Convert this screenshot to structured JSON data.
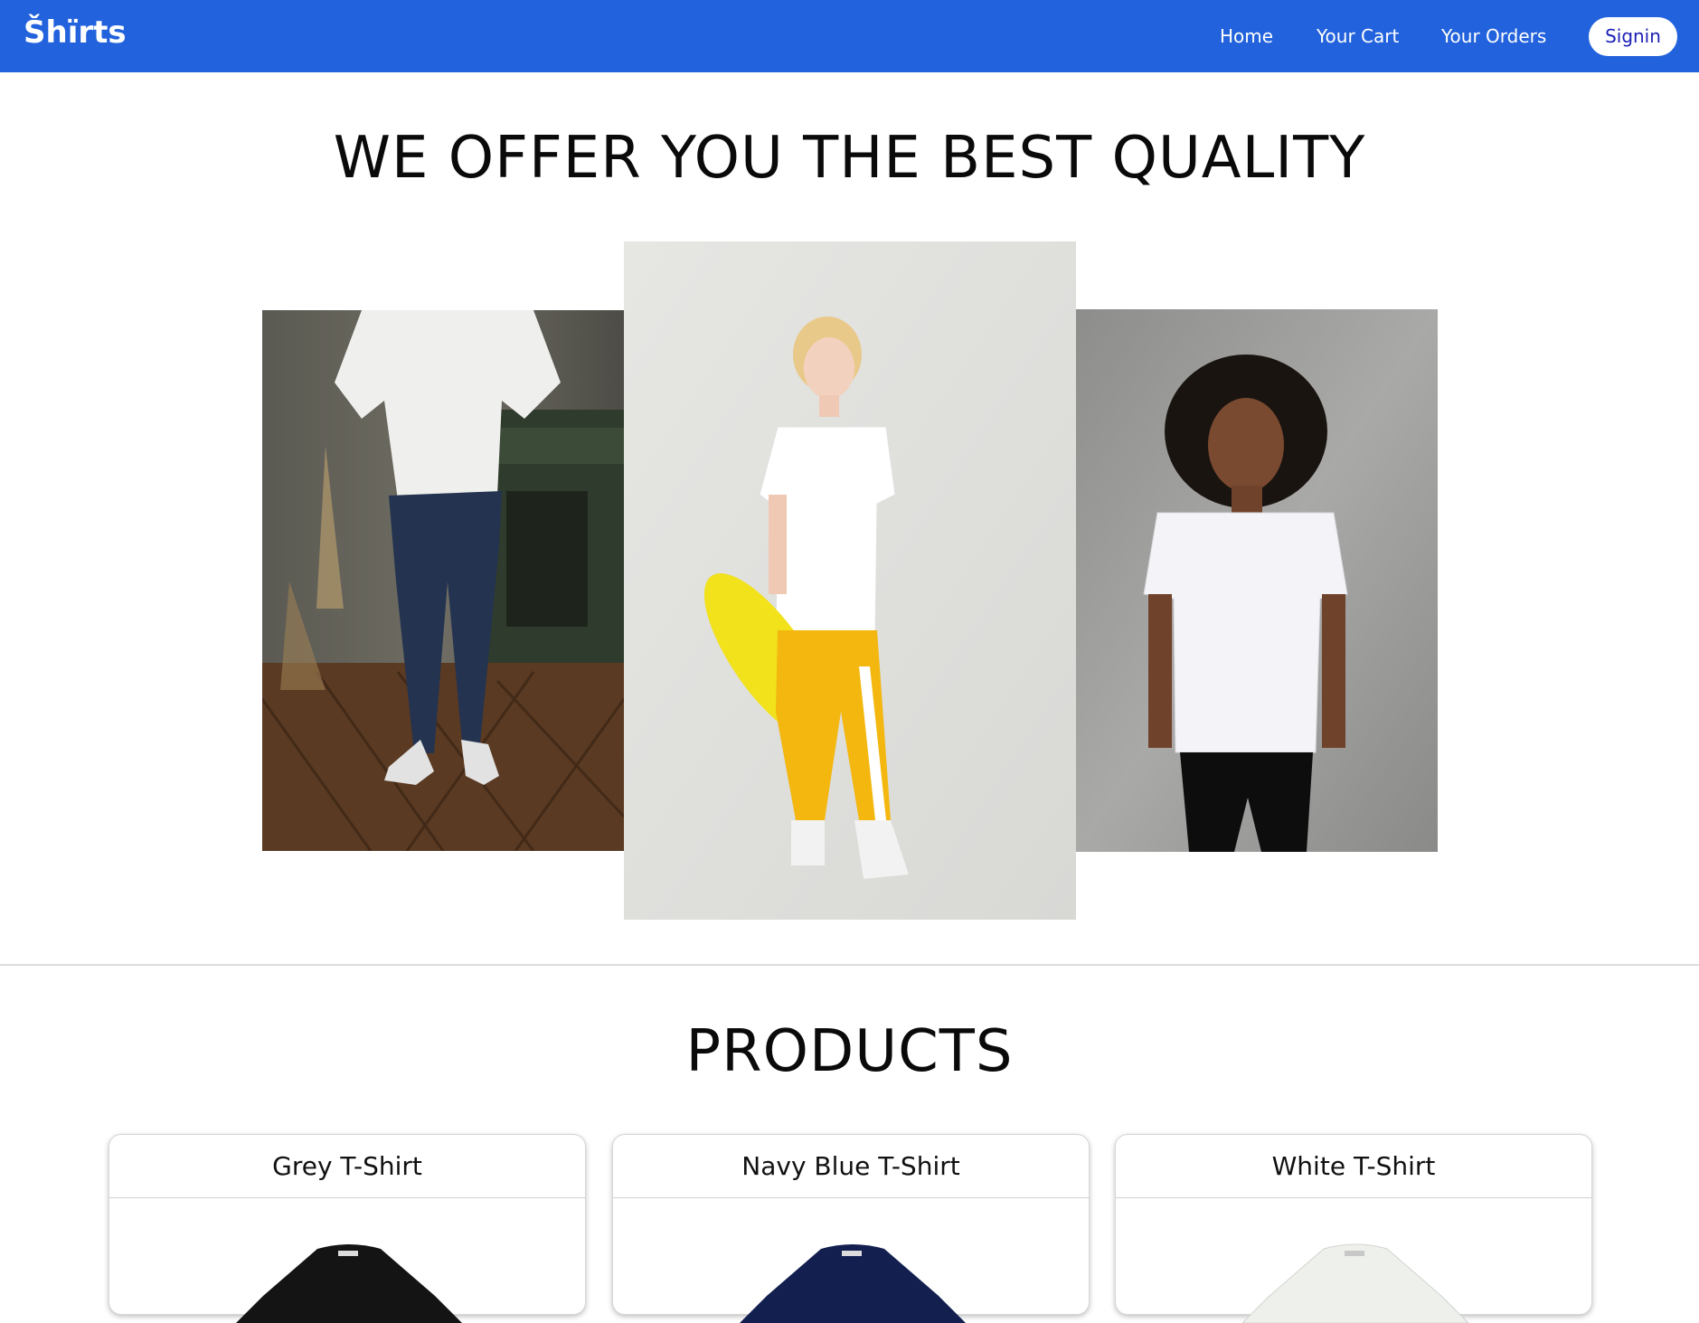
{
  "nav": {
    "brand": "Šhïrts",
    "links": [
      "Home",
      "Your Cart",
      "Your Orders"
    ],
    "signin": "Signin",
    "bar_color": "#2262dc",
    "signin_text_color": "#1b1fb5"
  },
  "hero": {
    "title": "WE OFFER YOU THE BEST QUALITY"
  },
  "products": {
    "title": "PRODUCTS",
    "items": [
      {
        "name": "Grey T-Shirt",
        "shirt_color": "#141414"
      },
      {
        "name": "Navy Blue T-Shirt",
        "shirt_color": "#13204f"
      },
      {
        "name": "White T-Shirt",
        "shirt_color": "#eef0ec"
      }
    ]
  }
}
